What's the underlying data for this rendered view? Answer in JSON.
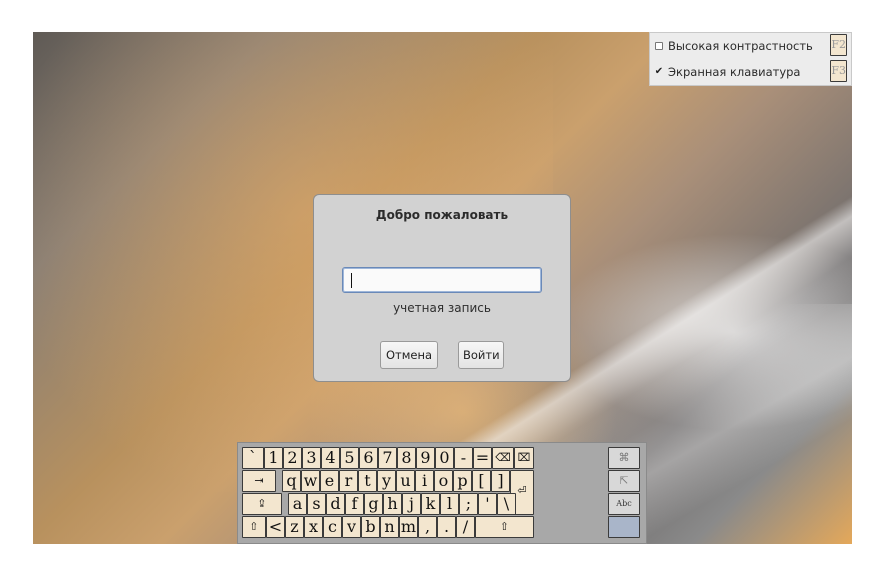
{
  "menu": {
    "items": [
      {
        "label": "Высокая контрастность",
        "shortcut": "F2",
        "checked": false
      },
      {
        "label": "Экранная клавиатура",
        "shortcut": "F3",
        "checked": true
      }
    ],
    "check_glyph": "✔"
  },
  "dialog": {
    "title": "Добро пожаловать",
    "username_value": "",
    "field_label": "учетная запись",
    "cancel_label": "Отмена",
    "login_label": "Войти"
  },
  "keyboard": {
    "row1": [
      "`",
      "1",
      "2",
      "3",
      "4",
      "5",
      "6",
      "7",
      "8",
      "9",
      "0",
      "-",
      "=",
      "⌫",
      "⌧"
    ],
    "row2": [
      "⇥",
      "q",
      "w",
      "e",
      "r",
      "t",
      "y",
      "u",
      "i",
      "o",
      "p",
      "[",
      "]"
    ],
    "row3": [
      "⇪",
      "a",
      "s",
      "d",
      "f",
      "g",
      "h",
      "j",
      "k",
      "l",
      ";",
      "'",
      "\\"
    ],
    "row4": [
      "⇧",
      "<",
      "z",
      "x",
      "c",
      "v",
      "b",
      "n",
      "m",
      ",",
      ".",
      "/",
      "⇧"
    ],
    "enter": "⏎",
    "side": {
      "close": "⌘",
      "pointer": "⇱",
      "mode": "Abc"
    }
  },
  "colors": {
    "dialog_bg": "#d2d2d2",
    "key_bg": "#f3e6cf",
    "menu_bg": "#ececec"
  }
}
